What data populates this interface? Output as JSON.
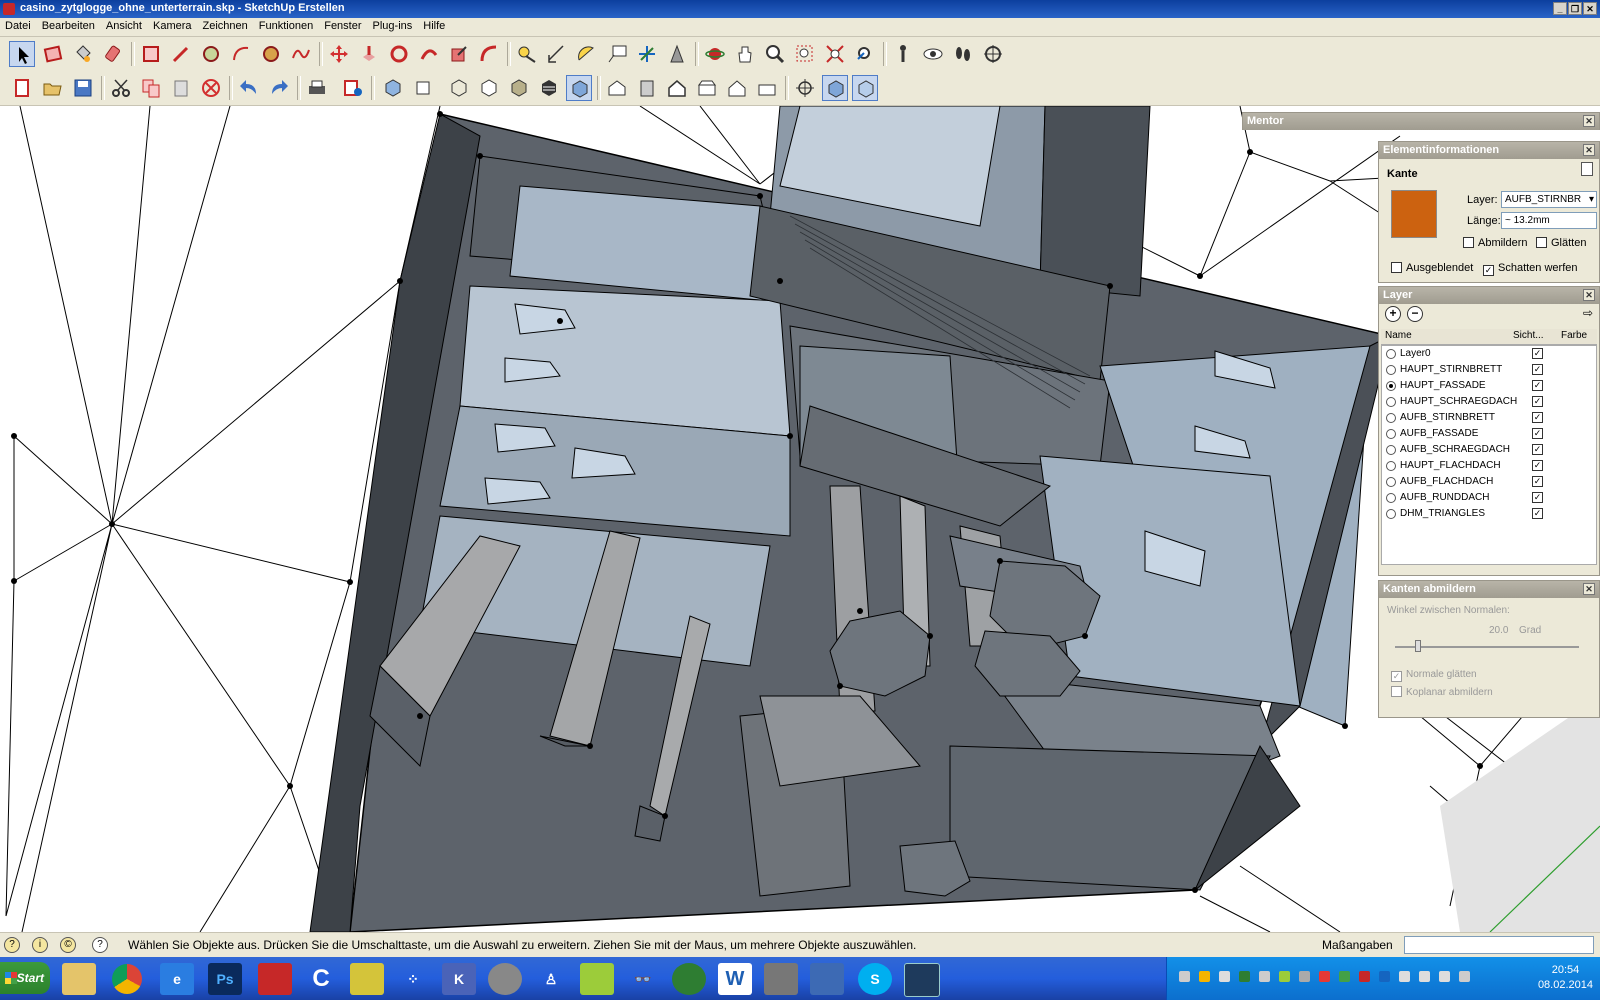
{
  "window": {
    "title": "casino_zytglogge_ohne_unterterrain.skp - SketchUp Erstellen"
  },
  "menu": [
    "Datei",
    "Bearbeiten",
    "Ansicht",
    "Kamera",
    "Zeichnen",
    "Funktionen",
    "Fenster",
    "Plug-ins",
    "Hilfe"
  ],
  "mentor": {
    "title": "Mentor"
  },
  "element_info": {
    "title": "Elementinformationen",
    "type": "Kante",
    "color": "#cc6210",
    "layer_label": "Layer:",
    "layer_value": "AUFB_STIRNBR",
    "length_label": "Länge:",
    "length_value": "~ 13.2mm",
    "abmildern": "Abmildern",
    "glaetten": "Glätten",
    "ausgeblendet": "Ausgeblendet",
    "schatten": "Schatten werfen"
  },
  "layers": {
    "title": "Layer",
    "col_name": "Name",
    "col_visible": "Sicht...",
    "col_color": "Farbe",
    "rows": [
      {
        "name": "Layer0",
        "active": false
      },
      {
        "name": "HAUPT_STIRNBRETT",
        "active": false
      },
      {
        "name": "HAUPT_FASSADE",
        "active": true
      },
      {
        "name": "HAUPT_SCHRAEGDACH",
        "active": false
      },
      {
        "name": "AUFB_STIRNBRETT",
        "active": false
      },
      {
        "name": "AUFB_FASSADE",
        "active": false
      },
      {
        "name": "AUFB_SCHRAEGDACH",
        "active": false
      },
      {
        "name": "HAUPT_FLACHDACH",
        "active": false
      },
      {
        "name": "AUFB_FLACHDACH",
        "active": false
      },
      {
        "name": "AUFB_RUNDDACH",
        "active": false
      },
      {
        "name": "DHM_TRIANGLES",
        "active": false
      }
    ]
  },
  "kanten": {
    "title": "Kanten abmildern",
    "angle_label": "Winkel zwischen Normalen:",
    "angle_value": "20.0",
    "angle_unit": "Grad",
    "normale": "Normale glätten",
    "koplanar": "Koplanar abmildern"
  },
  "status": {
    "message": "Wählen Sie Objekte aus. Drücken Sie die Umschalttaste, um die Auswahl zu erweitern. Ziehen Sie mit der Maus, um mehrere Objekte auszuwählen.",
    "measure_label": "Maßangaben"
  },
  "taskbar": {
    "start": "Start",
    "time": "20:54",
    "date": "08.02.2014"
  }
}
